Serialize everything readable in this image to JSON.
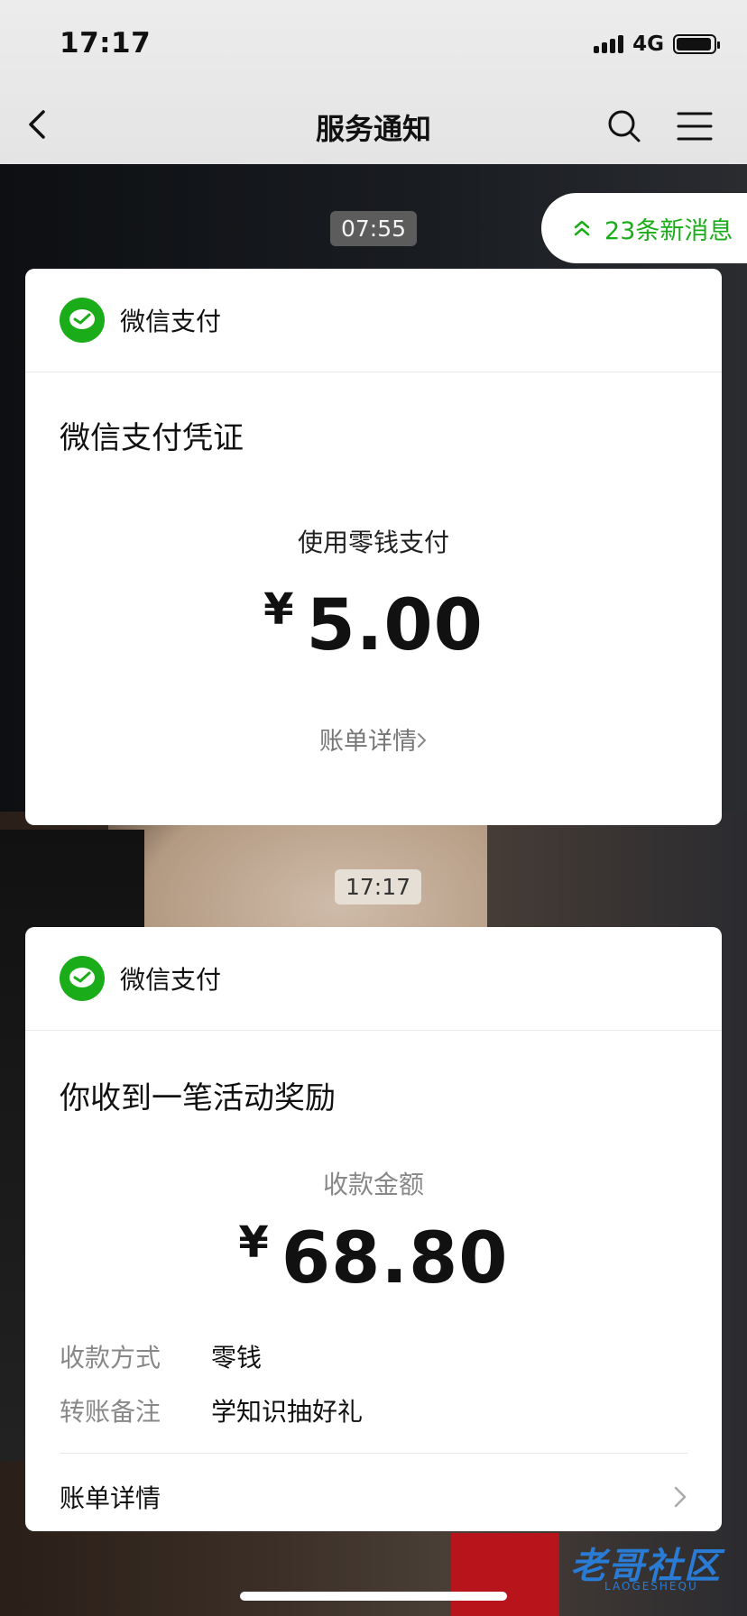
{
  "status_bar": {
    "time": "17:17",
    "network": "4G"
  },
  "nav": {
    "title": "服务通知"
  },
  "new_messages": {
    "label": "23条新消息"
  },
  "messages": [
    {
      "timestamp": "07:55",
      "sender": "微信支付",
      "title": "微信支付凭证",
      "subtitle": "使用零钱支付",
      "currency": "¥",
      "amount": "5.00",
      "detail_link": "账单详情"
    },
    {
      "timestamp": "17:17",
      "sender": "微信支付",
      "title": "你收到一笔活动奖励",
      "subtitle": "收款金额",
      "currency": "¥",
      "amount": "68.80",
      "rows": [
        {
          "label": "收款方式",
          "value": "零钱"
        },
        {
          "label": "转账备注",
          "value": "学知识抽好礼"
        }
      ],
      "detail_link": "账单详情"
    }
  ],
  "watermark": {
    "main": "老哥社区",
    "sub": "LAOGESHEQU"
  },
  "colors": {
    "wechat_green": "#1aad19",
    "nav_bg": "#e8e8e8"
  }
}
